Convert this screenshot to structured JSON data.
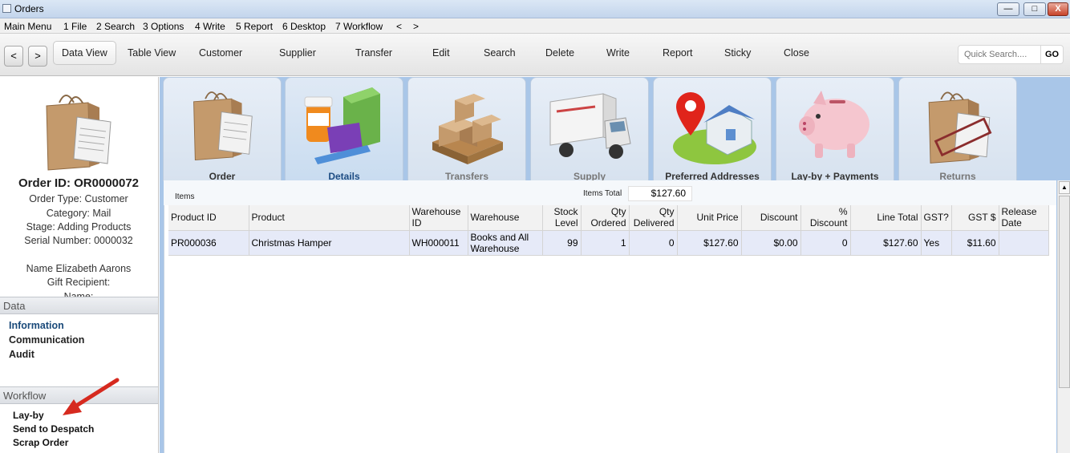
{
  "window": {
    "title": "Orders",
    "min": "—",
    "max": "□",
    "close": "X"
  },
  "menubar": [
    "Main Menu",
    "1 File",
    "2 Search",
    "3 Options",
    "4 Write",
    "5 Report",
    "6 Desktop",
    "7 Workflow",
    "<",
    ">"
  ],
  "toolbar": {
    "back": "<",
    "forward": ">",
    "items": [
      "Data View",
      "Table View",
      "Customer",
      "Supplier",
      "Transfer",
      "Edit",
      "Search",
      "Delete",
      "Write",
      "Report",
      "Sticky",
      "Close"
    ],
    "quick_search_placeholder": "Quick Search....",
    "go_label": "GO"
  },
  "order": {
    "id_line": "Order ID: OR0000072",
    "type_line": "Order Type: Customer",
    "category_line": "Category: Mail",
    "stage_line": "Stage: Adding Products",
    "serial_line": "Serial Number: 0000032",
    "name_line": "Name Elizabeth Aarons",
    "gift_line": "Gift Recipient:",
    "gift_name_line": "Name:"
  },
  "sidebar": {
    "data_heading": "Data",
    "data_links": [
      "Information",
      "Communication",
      "Audit"
    ],
    "workflow_heading": "Workflow",
    "workflow_links": [
      "Lay-by",
      "Send to Despatch",
      "Scrap Order"
    ]
  },
  "tiles": [
    "Order",
    "Details",
    "Transfers",
    "Supply",
    "Preferred Addresses",
    "Lay-by + Payments",
    "Returns"
  ],
  "items": {
    "label": "Items",
    "total_label": "Items Total",
    "total_value": "$127.60",
    "columns": [
      "Product ID",
      "Product",
      "Warehouse ID",
      "Warehouse",
      "Stock Level",
      "Qty Ordered",
      "Qty Delivered",
      "Unit Price",
      "Discount",
      "% Discount",
      "Line Total",
      "GST?",
      "GST $",
      "Release Date"
    ],
    "rows": [
      [
        "PR000036",
        "Christmas Hamper",
        "WH000011",
        "Books and All Warehouse",
        "99",
        "1",
        "0",
        "$127.60",
        "$0.00",
        "0",
        "$127.60",
        "Yes",
        "$11.60",
        ""
      ]
    ]
  }
}
